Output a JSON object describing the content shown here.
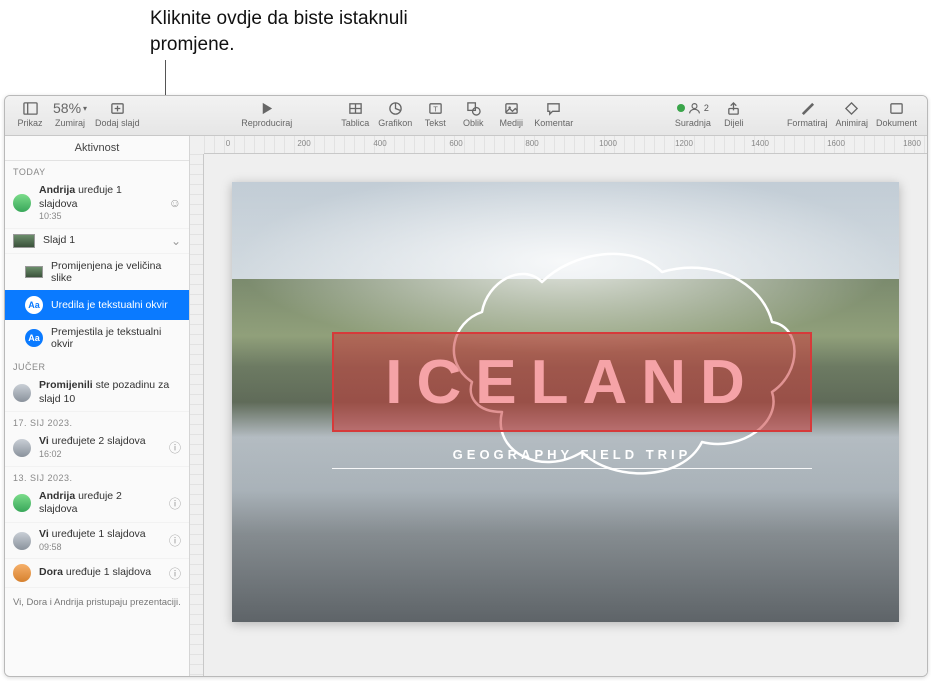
{
  "callout": "Kliknite ovdje da biste istaknuli promjene.",
  "toolbar": {
    "view": "Prikaz",
    "zoom_label": "Zumiraj",
    "zoom_value": "58%",
    "add_slide": "Dodaj slajd",
    "play": "Reproduciraj",
    "table": "Tablica",
    "chart": "Grafikon",
    "text": "Tekst",
    "shape": "Oblik",
    "media": "Mediji",
    "comment": "Komentar",
    "collab": "Suradnja",
    "collab_count": "2",
    "share": "Dijeli",
    "format": "Formatiraj",
    "animate": "Animiraj",
    "document": "Dokument"
  },
  "sidebar": {
    "title": "Aktivnost",
    "sections": {
      "today": "TODAY",
      "yesterday": "JUČER",
      "d17": "17. SIJ 2023.",
      "d13": "13. SIJ 2023."
    },
    "entries": {
      "e0_main": "<b>Andrija</b> uređuje 1 slajdova",
      "e0_time": "10:35",
      "e1_slide": "Slajd 1",
      "e1_a": "Promijenjena je veličina slike",
      "e1_b": "Uredila je tekstualni okvir",
      "e1_c": "Premjestila je tekstualni okvir",
      "e2_main": "<b>Promijenili</b> ste pozadinu za slajd 10",
      "e3_main": "<b>Vi</b> uređujete 2 slajdova",
      "e3_time": "16:02",
      "e4_main": "<b>Andrija</b> uređuje 2 slajdova",
      "e5_main": "<b>Vi</b> uređujete 1 slajdova",
      "e5_time": "09:58",
      "e6_main": "<b>Dora</b> uređuje 1 slajdova",
      "footer": "Vi, Dora i Andrija pristupaju prezentaciji."
    }
  },
  "slide": {
    "title": "ICELAND",
    "subtitle": "GEOGRAPHY FIELD TRIP"
  },
  "ruler": [
    "0",
    "200",
    "400",
    "600",
    "800",
    "1000",
    "1200",
    "1400",
    "1600",
    "1800"
  ]
}
